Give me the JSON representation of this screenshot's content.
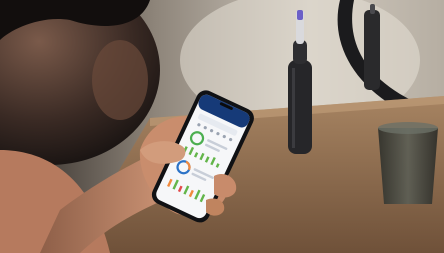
{
  "scene": {
    "colors": {
      "background": "#b9b2a8",
      "shelf": "#8a6a4e",
      "toothbrush": "#262629",
      "glass": "#3a3b36",
      "mirror_frame": "#1b1b1d",
      "skin": "#c98d6d",
      "phone_body": "#101114",
      "app_header": "#163a78",
      "ring_green": "#4caf50",
      "ring_blue": "#2c73c7",
      "bar_green": "#63b54a",
      "bar_orange": "#f28a3d",
      "bar_red": "#e24b4b"
    },
    "objects": [
      "person-head",
      "hand",
      "smartphone",
      "toothbrush",
      "toothbrush-charger",
      "drinking-glass",
      "round-mirror",
      "wooden-shelf"
    ]
  }
}
